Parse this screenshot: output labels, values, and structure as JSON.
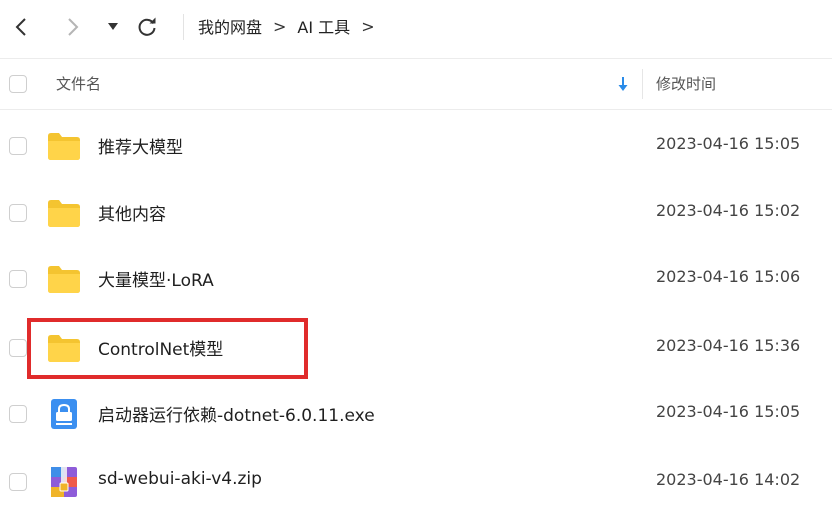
{
  "toolbar": {
    "back_icon": "chevron-left-icon",
    "forward_icon": "chevron-right-icon",
    "dropdown_icon": "caret-down-icon",
    "refresh_icon": "refresh-icon"
  },
  "breadcrumb": {
    "items": [
      "我的网盘",
      "AI 工具"
    ],
    "separator": ">"
  },
  "table": {
    "headers": {
      "name": "文件名",
      "modified": "修改时间"
    },
    "sort_icon": "arrow-down-icon",
    "accent_color": "#2a8be8",
    "rows": [
      {
        "type": "folder",
        "icon": "folder-icon",
        "name": "推荐大模型",
        "date": "2023-04-16 15:05"
      },
      {
        "type": "folder",
        "icon": "folder-icon",
        "name": "其他内容",
        "date": "2023-04-16 15:02"
      },
      {
        "type": "folder",
        "icon": "folder-icon",
        "name": "大量模型·LoRA",
        "date": "2023-04-16 15:06"
      },
      {
        "type": "folder",
        "icon": "folder-icon",
        "name": "ControlNet模型",
        "date": "2023-04-16 15:36"
      },
      {
        "type": "exe",
        "icon": "installer-icon",
        "name": "启动器运行依赖-dotnet-6.0.11.exe",
        "date": "2023-04-16 15:05"
      },
      {
        "type": "zip",
        "icon": "zip-archive-icon",
        "name": "sd-webui-aki-v4.zip",
        "date": "2023-04-16 14:02"
      }
    ]
  },
  "annotation": {
    "highlight_color": "#e02b2b"
  }
}
